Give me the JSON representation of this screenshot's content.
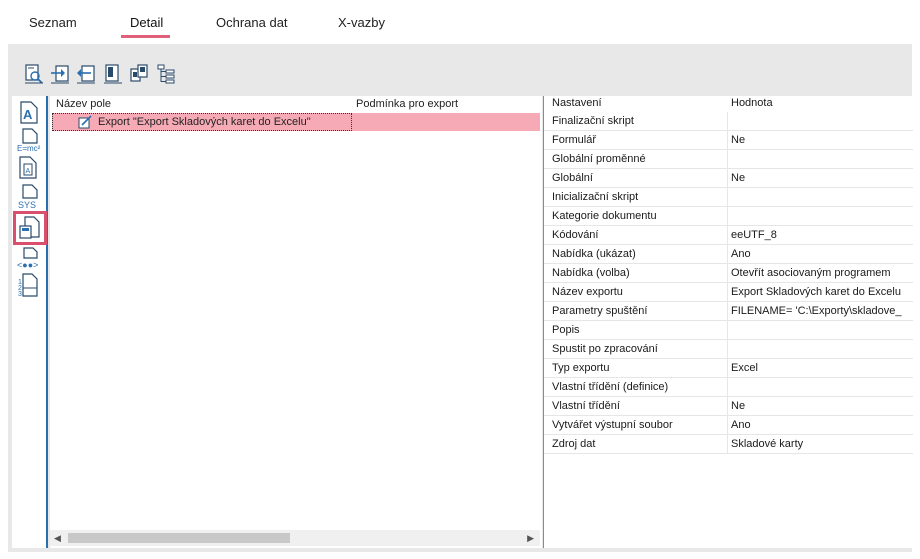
{
  "tabs": [
    {
      "label": "Seznam",
      "active": false
    },
    {
      "label": "Detail",
      "active": true
    },
    {
      "label": "Ochrana dat",
      "active": false
    },
    {
      "label": "X-vazby",
      "active": false
    }
  ],
  "toolbar": {
    "icons": [
      "preview-icon",
      "import-icon",
      "export-icon",
      "copy-page-icon",
      "copy-multi-icon",
      "tree-structure-icon"
    ]
  },
  "sidebar": {
    "icons": [
      "field-a-icon",
      "formula-icon",
      "document-a-icon",
      "sys-icon",
      "export-document-icon",
      "connection-icon",
      "numbered-list-icon"
    ],
    "selected_index": 4
  },
  "list": {
    "col_name": "Název pole",
    "col_condition": "Podmínka pro export",
    "rows": [
      {
        "name": "Export \"Export Skladových karet do Excelu\"",
        "condition": ""
      }
    ]
  },
  "properties": {
    "col_setting": "Nastavení",
    "col_value": "Hodnota",
    "rows": [
      {
        "name": "Finalizační skript",
        "value": ""
      },
      {
        "name": "Formulář",
        "value": "Ne"
      },
      {
        "name": "Globální proměnné",
        "value": ""
      },
      {
        "name": "Globální",
        "value": "Ne"
      },
      {
        "name": "Inicializační skript",
        "value": ""
      },
      {
        "name": "Kategorie dokumentu",
        "value": ""
      },
      {
        "name": "Kódování",
        "value": "eeUTF_8"
      },
      {
        "name": "Nabídka (ukázat)",
        "value": "Ano"
      },
      {
        "name": "Nabídka (volba)",
        "value": "Otevřít asociovaným programem"
      },
      {
        "name": "Název exportu",
        "value": "Export Skladových karet do Excelu"
      },
      {
        "name": "Parametry spuštění",
        "value": "FILENAME=    'C:\\Exporty\\skladove_"
      },
      {
        "name": "Popis",
        "value": ""
      },
      {
        "name": "Spustit po zpracování",
        "value": ""
      },
      {
        "name": "Typ exportu",
        "value": "Excel"
      },
      {
        "name": "Vlastní třídění (definice)",
        "value": ""
      },
      {
        "name": "Vlastní třídění",
        "value": "Ne"
      },
      {
        "name": "Vytvářet výstupní soubor",
        "value": "Ano"
      },
      {
        "name": "Zdroj dat",
        "value": "Skladové karty"
      }
    ]
  },
  "colors": {
    "accent": "#e0607a",
    "selection": "#f5aab6",
    "sidebar_border": "#2a6fb0",
    "icon_blue": "#2a6fb0"
  }
}
